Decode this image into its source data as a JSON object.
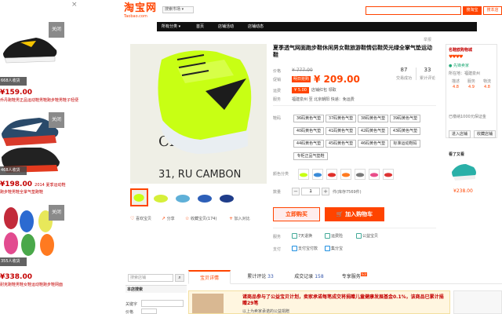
{
  "ads": {
    "close": "×",
    "items": [
      {
        "tag": "关闭",
        "sold": "668人收货",
        "price": "¥159.00",
        "price_note": "",
        "desc": "乔丹跑鞋男正品运动鞋男鞋跑步鞋男鞋子轻便"
      },
      {
        "tag": "关闭",
        "sold": "",
        "price": "",
        "price_note": "",
        "desc": ""
      },
      {
        "tag": "关闭",
        "sold": "468人收货",
        "price": "¥198.00",
        "price_note": "2014 夏季运动鞋",
        "desc": "跑步鞋男鞋全掌气垫跑鞋"
      },
      {
        "tag": "关闭",
        "sold": "355人收货",
        "price": "¥338.00",
        "price_note": "",
        "desc": "耐克跑鞋男鞋女鞋运动鞋跑步鞋网面"
      }
    ]
  },
  "header": {
    "logo": "淘宝网",
    "logo_sub": "Taobao.com",
    "market": "搜索市场 ▾",
    "search_placeholder": "",
    "search_taobao": "搜淘宝",
    "search_shop": "搜本店"
  },
  "nav": [
    "所有分类 ▾",
    "首页",
    "店铺活动",
    "店铺动态"
  ],
  "product": {
    "title": "夏季透气网面跑步鞋休闲男女鞋旅游鞋情侣鞋荧光绿全掌气垫运动鞋",
    "report": "举报",
    "label_price": "价格",
    "label_promo": "促销",
    "label_ship": "运费",
    "label_service": "服务",
    "orig_price": "¥ 777.00",
    "promo_badge": "明日抢购",
    "price": "¥ 209.00",
    "ship_badge": "¥ 5.00",
    "ship_text": "店铺红包   领取",
    "service_text": "福建泉州 至 北京朝阳   快递：免运费",
    "stats": [
      {
        "num": "87",
        "label": "交易成功"
      },
      {
        "num": "33",
        "label": "累计评论"
      }
    ],
    "label_size": "鞋码",
    "sizes": [
      "36码黄色气垫",
      "37码黄色气垫",
      "38码黄色气垫",
      "39码黄色气垫",
      "40码黄色气垫",
      "41码黄色气垫",
      "42码黄色气垫",
      "43码黄色气垫",
      "44码黄色气垫",
      "45码黄色气垫",
      "46码黄色气垫",
      "标准运动鞋码",
      "专柜正品气垫鞋"
    ],
    "label_color": "颜色分类",
    "label_qty": "数量",
    "qty_minus": "−",
    "qty_value": "1",
    "qty_plus": "+",
    "stock": "件(库存7569件)",
    "buy_now": "立即购买",
    "add_cart": "🛒 加入购物车",
    "label_commit": "服务",
    "label_pay": "支付",
    "services": [
      "7天退换",
      "运费险",
      "公益宝贝"
    ],
    "payments": [
      "支付宝付款",
      "集分宝"
    ],
    "actions": [
      {
        "icon": "♡",
        "label": "喜欢宝贝"
      },
      {
        "icon": "↗",
        "label": "分享"
      },
      {
        "icon": "☆",
        "label": "收藏宝贝(174)"
      },
      {
        "icon": "+",
        "label": "加入对比"
      }
    ]
  },
  "store": {
    "name": "名鞋欧购物城",
    "hearts": "♥♥♥♥",
    "type": "●  先锋卖家",
    "location": "所在地：福建泉州",
    "scores": [
      {
        "label": "描述",
        "value": "4.8"
      },
      {
        "label": "服务",
        "value": "4.9"
      },
      {
        "label": "物流",
        "value": "4.8"
      }
    ],
    "deposit": "已缴纳1000元保证金",
    "enter": "进入店铺",
    "fav": "收藏店铺",
    "watched_title": "看了又看",
    "watched_price": "¥238.00"
  },
  "bottom": {
    "search_placeholder": "搜索店铺",
    "shop_search_title": "本店搜索",
    "kw_label": "关键字",
    "price_label": "价格",
    "tabs": [
      {
        "label": "宝贝详情",
        "count": ""
      },
      {
        "label": "累计评论",
        "count": "33"
      },
      {
        "label": "成交记录",
        "count": "158"
      },
      {
        "label": "专享服务",
        "count": ""
      }
    ],
    "hot": "hot",
    "banner_text": "诸商品参与了公益宝贝计划，卖家承诺每笔成交将捐赠儿童健康发展基金0.1%，该商品已累计捐赠29笔",
    "banner_sub": "以上为卖家承诺的公益捐赠"
  }
}
